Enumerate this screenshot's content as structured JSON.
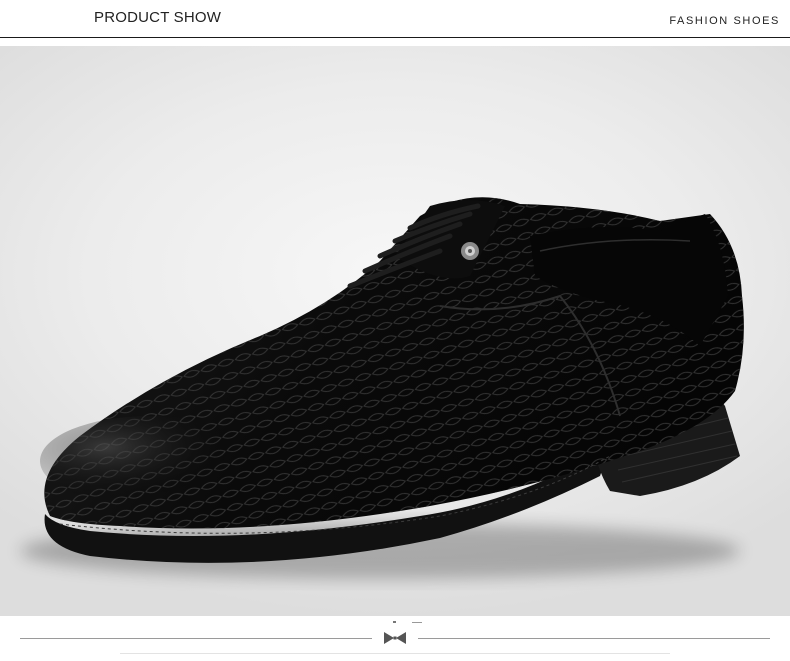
{
  "header": {
    "title": "PRODUCT SHOW",
    "subtitle": "FASHION SHOES"
  },
  "photo": {
    "subject": "black crocodile-embossed leather lace-up oxford shoe with block heel",
    "background_color": "#e8e8e8",
    "shoe_color": "#0c0c0c"
  },
  "footer": {
    "divider_icon": "bowtie-icon"
  }
}
